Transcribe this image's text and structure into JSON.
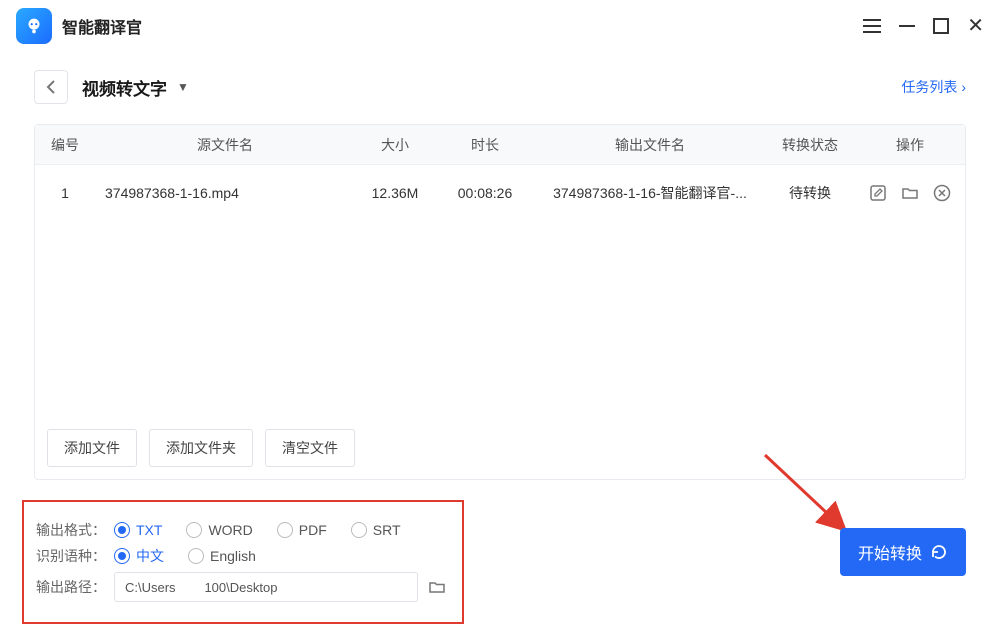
{
  "app": {
    "title": "智能翻译官"
  },
  "breadcrumb": {
    "title": "视频转文字",
    "task_link": "任务列表"
  },
  "table": {
    "headers": {
      "num": "编号",
      "src": "源文件名",
      "size": "大小",
      "dur": "时长",
      "out": "输出文件名",
      "stat": "转换状态",
      "act": "操作"
    },
    "rows": [
      {
        "num": "1",
        "src": "374987368-1-16.mp4",
        "size": "12.36M",
        "dur": "00:08:26",
        "out": "374987368-1-16-智能翻译官-...",
        "stat": "待转换"
      }
    ]
  },
  "filebtns": {
    "addfile": "添加文件",
    "addfolder": "添加文件夹",
    "clear": "清空文件"
  },
  "settings": {
    "fmt_label": "输出格式：",
    "formats": [
      "TXT",
      "WORD",
      "PDF",
      "SRT"
    ],
    "lang_label": "识别语种：",
    "langs": [
      "中文",
      "English"
    ],
    "path_label": "输出路径：",
    "path_value": "C:\\Users        100\\Desktop"
  },
  "start_btn": "开始转换"
}
